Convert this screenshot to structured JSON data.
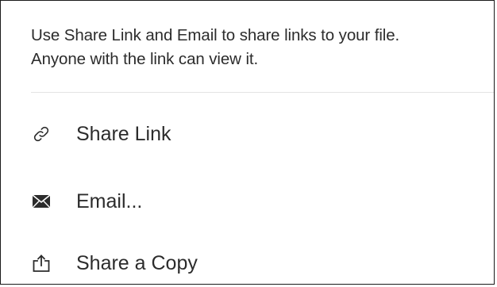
{
  "description": {
    "line1": "Use Share Link and Email to share links to your file.",
    "line2": "Anyone with the link can view it."
  },
  "menu": {
    "items": [
      {
        "label": "Share Link",
        "icon": "link-icon"
      },
      {
        "label": "Email...",
        "icon": "envelope-icon"
      },
      {
        "label": "Share a Copy",
        "icon": "share-upload-icon"
      }
    ]
  },
  "colors": {
    "text": "#2c2c2c",
    "divider": "#e3e3e3",
    "border": "#1a1a1a",
    "background": "#ffffff"
  }
}
